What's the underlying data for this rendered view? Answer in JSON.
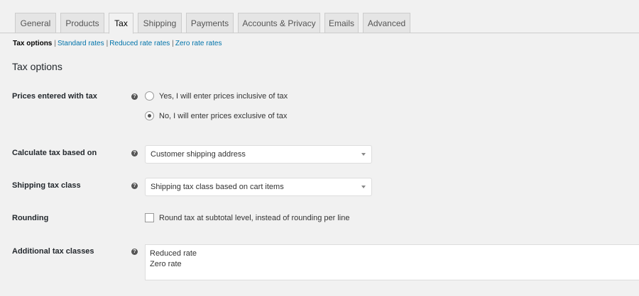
{
  "tabs": [
    {
      "label": "General"
    },
    {
      "label": "Products"
    },
    {
      "label": "Tax",
      "active": true
    },
    {
      "label": "Shipping"
    },
    {
      "label": "Payments"
    },
    {
      "label": "Accounts & Privacy"
    },
    {
      "label": "Emails"
    },
    {
      "label": "Advanced"
    }
  ],
  "subnav": {
    "current": "Tax options",
    "links": [
      "Standard rates",
      "Reduced rate rates",
      "Zero rate rates"
    ],
    "separator": "|"
  },
  "section_title": "Tax options",
  "help_icon_glyph": "?",
  "fields": {
    "prices_entered": {
      "label": "Prices entered with tax",
      "options": [
        {
          "label": "Yes, I will enter prices inclusive of tax",
          "checked": false
        },
        {
          "label": "No, I will enter prices exclusive of tax",
          "checked": true
        }
      ]
    },
    "calculate_based_on": {
      "label": "Calculate tax based on",
      "value": "Customer shipping address"
    },
    "shipping_tax_class": {
      "label": "Shipping tax class",
      "value": "Shipping tax class based on cart items"
    },
    "rounding": {
      "label": "Rounding",
      "checkbox_label": "Round tax at subtotal level, instead of rounding per line",
      "checked": false
    },
    "additional_tax_classes": {
      "label": "Additional tax classes",
      "value": "Reduced rate\nZero rate"
    }
  }
}
